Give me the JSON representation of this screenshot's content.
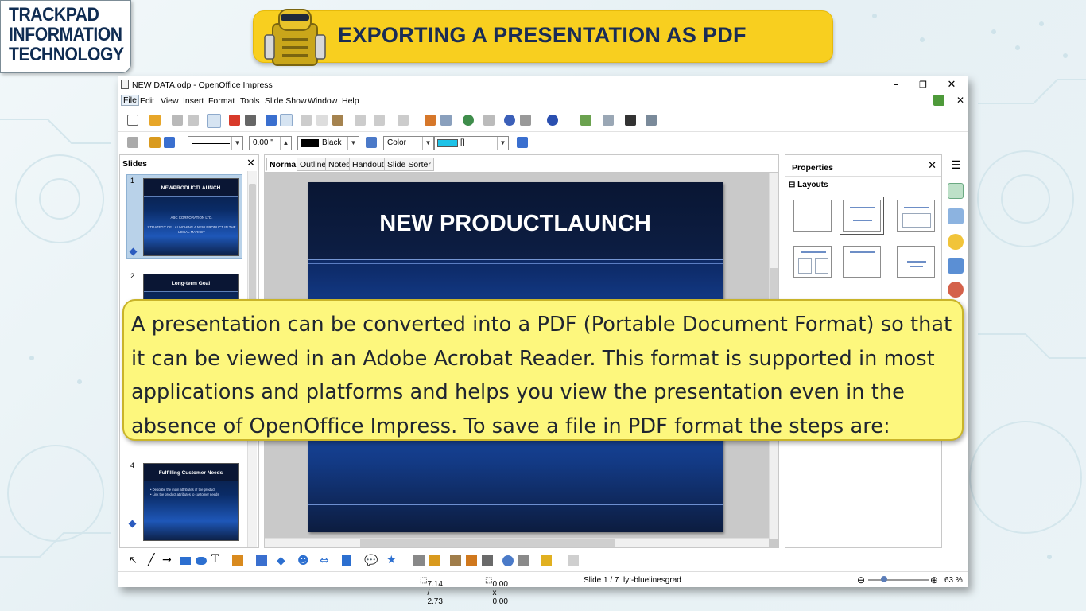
{
  "logo": {
    "line1": "TRACKPAD",
    "line2": "INFORMATION",
    "line3": "TECHNOLOGY"
  },
  "banner": {
    "text": "EXPORTING A PRESENTATION AS PDF"
  },
  "window": {
    "title": "NEW DATA.odp - OpenOffice Impress",
    "controls": {
      "minimize": "–",
      "maximize": "❐",
      "close": "✕"
    }
  },
  "menu": [
    "File",
    "Edit",
    "View",
    "Insert",
    "Format",
    "Tools",
    "Slide Show",
    "Window",
    "Help"
  ],
  "menu_close": "✕",
  "toolbar2": {
    "line_width": "0.00 \"",
    "line_color": "Black",
    "area_style": "Color",
    "area_fill": "[]",
    "line_color_hex": "#000000",
    "area_fill_hex": "#1ec3e8"
  },
  "slides_pane": {
    "title": "Slides",
    "close": "✕",
    "thumbs": [
      {
        "num": "1",
        "title": "NEWPRODUCTLAUNCH",
        "sub": "ABC CORPORATION LTD.\n\nSTRATEGY OF LAUNCHING A NEW PRODUCT IN THE LOCAL MARKET"
      },
      {
        "num": "2",
        "title": "Long-term Goal"
      },
      {
        "num": "4",
        "title": "Fulfilling Customer Needs",
        "bullets": "•  Describe the main attributes of the product\n•  Link the product attributes to customer needs"
      }
    ]
  },
  "view_tabs": [
    "Normal",
    "Outline",
    "Notes",
    "Handout",
    "Slide Sorter"
  ],
  "main_slide": {
    "title": "NEW PRODUCTLAUNCH"
  },
  "properties": {
    "title": "Properties",
    "close": "✕",
    "section": "Layouts",
    "section_toggle": "⊟"
  },
  "status": {
    "position": "7.14 / 2.73",
    "size": "0.00 x 0.00",
    "slide": "Slide 1 / 7",
    "layout": "lyt-bluelinesgrad",
    "zoom": "63 %"
  },
  "callout": {
    "text": "A presentation can be converted into a PDF (Portable Document Format) so that it can be viewed in an Adobe Acrobat Reader. This format is supported in most applications and platforms and helps you view the presentation even in the absence of OpenOffice Impress. To save a file in PDF format the steps are:"
  },
  "colors": {
    "banner": "#f8cf1f",
    "callout": "#fdf77d",
    "slide_blue": "#1d57c0"
  }
}
